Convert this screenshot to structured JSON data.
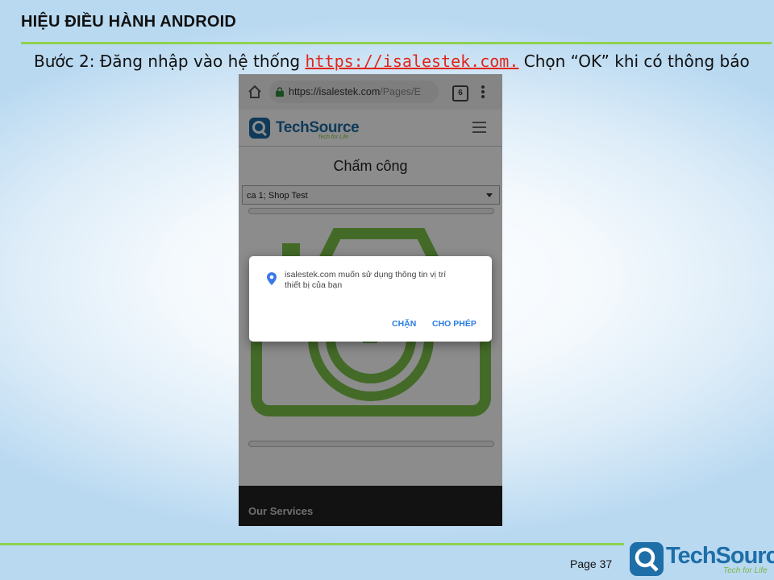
{
  "slide": {
    "title": "HIỆU ĐIỀU HÀNH ANDROID",
    "instruction_before": "Bước 2: Đăng nhập vào hệ thống ",
    "instruction_link": "https://isalestek.com.",
    "instruction_after": " Chọn “OK” khi có thông báo",
    "page_label": "Page 37",
    "brand_name": "TechSource",
    "brand_tagline": "Tech for Life"
  },
  "phone": {
    "url_host": "https://isalestek.com",
    "url_path": "/Pages/E",
    "tab_count": "6",
    "site_logo": "TechSource",
    "site_tagline": "Tech for Life",
    "heading": "Chấm công",
    "shop_select_value": "ca 1; Shop Test",
    "footer_section": "Our Services",
    "dialog": {
      "message": "isalestek.com muốn sử dụng thông tin vị trí thiết bị của bạn",
      "block_label": "CHẶN",
      "allow_label": "CHO PHÉP"
    }
  },
  "colors": {
    "accent_green": "#8fd14f",
    "link_red": "#e0261b",
    "dialog_button_blue": "#2a7ee0",
    "brand_blue": "#1e6ea8"
  },
  "icons": [
    "home-icon",
    "lock-icon",
    "tabs-icon",
    "overflow-menu-icon",
    "hamburger-menu-icon",
    "location-pin-icon",
    "camera-icon",
    "techsource-logo-icon"
  ]
}
